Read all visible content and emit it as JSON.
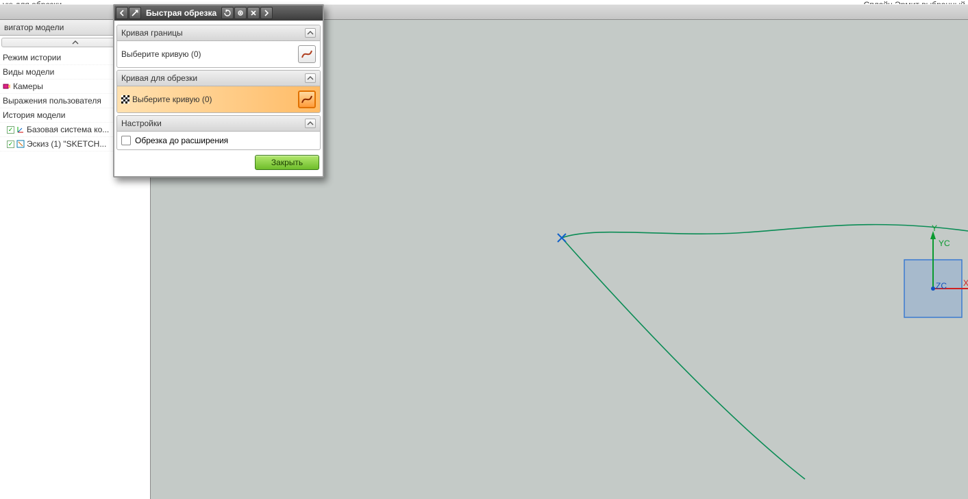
{
  "topbar": {
    "left_hint": "ую для обрезки",
    "right_hint": "Сплайн  Эрмит  выбранный"
  },
  "sidebar": {
    "title": "вигатор модели",
    "items": [
      {
        "label": "Режим истории"
      },
      {
        "label": "Виды модели"
      },
      {
        "label": "Камеры"
      },
      {
        "label": "Выражения пользователя"
      },
      {
        "label": "История модели"
      },
      {
        "label": "Базовая система ко...",
        "indent": true,
        "checked": true
      },
      {
        "label": "Эскиз (1) \"SKETCH...",
        "indent": true,
        "checked": true
      }
    ]
  },
  "dialog": {
    "title": "Быстрая обрезка",
    "section1": {
      "header": "Кривая границы",
      "row_label": "Выберите кривую (0)"
    },
    "section2": {
      "header": "Кривая для обрезки",
      "row_label": "Выберите кривую (0)"
    },
    "section3": {
      "header": "Настройки",
      "check_label": "Обрезка до расширения"
    },
    "close_label": "Закрыть"
  },
  "viewport": {
    "axes": {
      "y": "YC",
      "z": "ZC",
      "x": "X",
      "yt": "Y"
    }
  }
}
